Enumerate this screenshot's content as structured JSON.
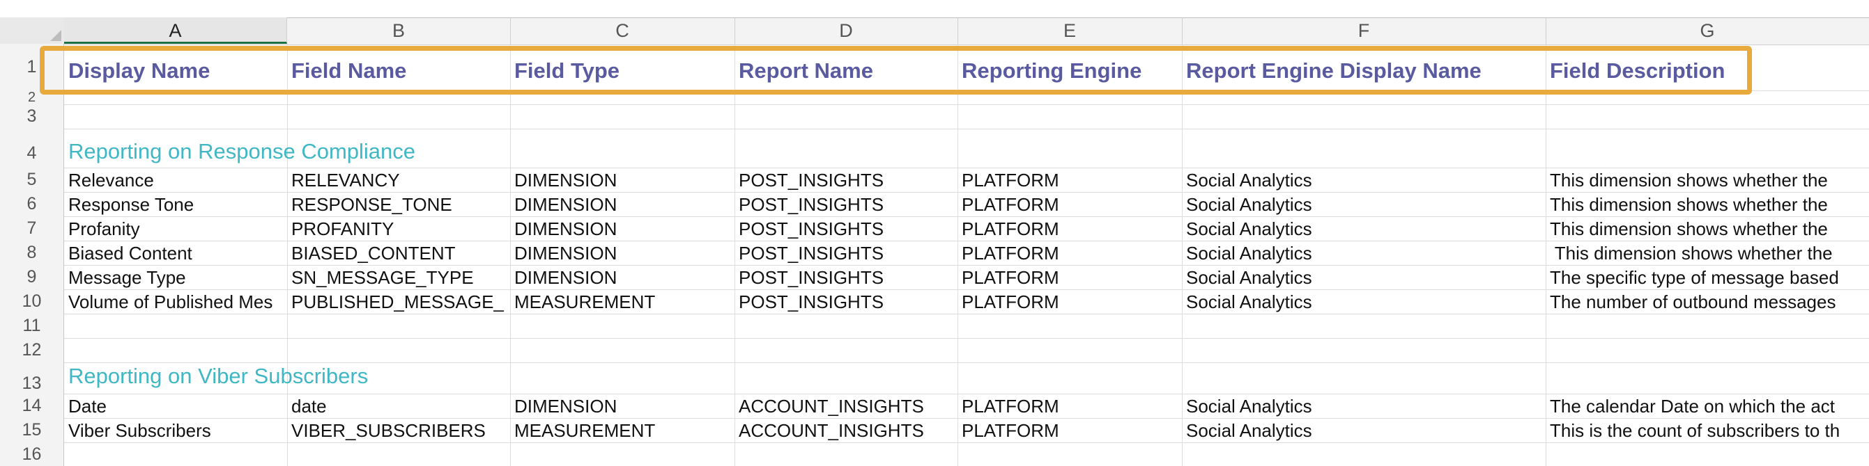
{
  "columns": [
    "A",
    "B",
    "C",
    "D",
    "E",
    "F",
    "G"
  ],
  "rows": [
    "1",
    "2",
    "3",
    "4",
    "5",
    "6",
    "7",
    "8",
    "9",
    "10",
    "11",
    "12",
    "13",
    "14",
    "15",
    "16"
  ],
  "header": {
    "display_name": "Display Name",
    "field_name": "Field Name",
    "field_type": "Field Type",
    "report_name": "Report Name",
    "reporting_engine": "Reporting Engine",
    "report_engine_display_name": "Report Engine Display Name",
    "field_description": "Field Description"
  },
  "sections": {
    "response_compliance": "Reporting on Response Compliance",
    "viber_subscribers": "Reporting on Viber Subscribers"
  },
  "data_rows": [
    [
      "Relevance",
      "RELEVANCY",
      "DIMENSION",
      "POST_INSIGHTS",
      "PLATFORM",
      "Social Analytics",
      "This dimension shows whether the"
    ],
    [
      "Response Tone",
      "RESPONSE_TONE",
      "DIMENSION",
      "POST_INSIGHTS",
      "PLATFORM",
      "Social Analytics",
      "This dimension shows whether the"
    ],
    [
      "Profanity",
      "PROFANITY",
      "DIMENSION",
      "POST_INSIGHTS",
      "PLATFORM",
      "Social Analytics",
      "This dimension shows whether the"
    ],
    [
      "Biased Content",
      "BIASED_CONTENT",
      "DIMENSION",
      "POST_INSIGHTS",
      "PLATFORM",
      "Social Analytics",
      " This dimension shows whether the"
    ],
    [
      "Message Type",
      "SN_MESSAGE_TYPE",
      "DIMENSION",
      "POST_INSIGHTS",
      "PLATFORM",
      "Social Analytics",
      "The specific type of message based"
    ],
    [
      "Volume of Published Mes",
      "PUBLISHED_MESSAGE_",
      "MEASUREMENT",
      "POST_INSIGHTS",
      "PLATFORM",
      "Social Analytics",
      "The number of outbound messages"
    ],
    [
      "Date",
      "date",
      "DIMENSION",
      "ACCOUNT_INSIGHTS",
      "PLATFORM",
      "Social Analytics",
      "The calendar Date on which the act"
    ],
    [
      "Viber Subscribers",
      "VIBER_SUBSCRIBERS",
      "MEASUREMENT",
      "ACCOUNT_INSIGHTS",
      "PLATFORM",
      "Social Analytics",
      "This is the count of subscribers to th"
    ]
  ],
  "colors": {
    "header_text": "#5a5aa0",
    "section_text": "#3fb7c4",
    "highlight_border": "#e8aa3c",
    "selected_column_underline": "#1e7145"
  }
}
